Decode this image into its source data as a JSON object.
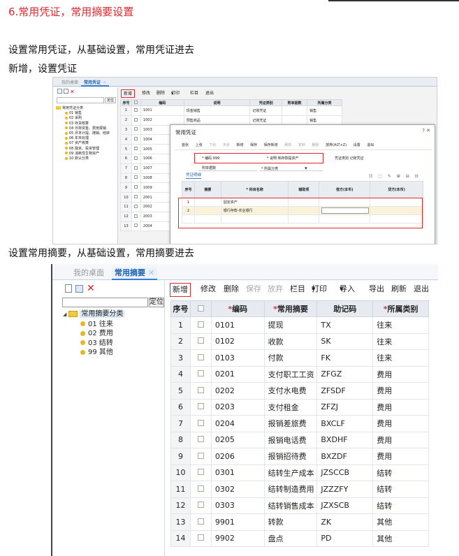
{
  "heading": "6.常用凭证，常用摘要设置",
  "para1": "设置常用凭证，从基础设置，常用凭证进去",
  "para2": "新增，设置凭证",
  "para3": "设置常用摘要，从基础设置，常用摘要进去",
  "shot1": {
    "tabs": [
      {
        "label": "我的桌面"
      },
      {
        "label": "常用凭证"
      }
    ],
    "close_glyph": "✕",
    "locate": "定位",
    "tree": {
      "root": "常用凭证分类",
      "children": [
        "01 销售",
        "02 采购",
        "03 存货核算",
        "04 日常资金、费用报销",
        "05 月末计提、摊销、结转",
        "06 年末处理",
        "07 资产核算",
        "08 融资、投资管理",
        "09 消耗性生物资产",
        "10 默认分类"
      ]
    },
    "toolbar": {
      "new": "新增",
      "edit": "修改",
      "delete": "删除",
      "print": "打印",
      "columns": "栏目",
      "exit": "退出"
    },
    "grid": {
      "headers": [
        "序号",
        "",
        "编码",
        "说明",
        "凭证类别",
        "附单据数",
        "所属分类"
      ],
      "rows": [
        [
          "1",
          "1001",
          "现金销售",
          "记账凭证",
          "销售"
        ],
        [
          "2",
          "1002",
          "预售商品",
          "记账凭证",
          "销售"
        ],
        [
          "3",
          "1003",
          "",
          "",
          ""
        ],
        [
          "4",
          "1004",
          "",
          "",
          ""
        ],
        [
          "5",
          "1005",
          "",
          "",
          ""
        ],
        [
          "6",
          "1006",
          "",
          "",
          ""
        ],
        [
          "7",
          "1007",
          "",
          "",
          ""
        ],
        [
          "8",
          "1008",
          "",
          "",
          ""
        ],
        [
          "9",
          "1009",
          "",
          "",
          ""
        ],
        [
          "10",
          "2001",
          "",
          "",
          ""
        ],
        [
          "11",
          "2002",
          "",
          "",
          ""
        ],
        [
          "12",
          "2003",
          "",
          "",
          ""
        ],
        [
          "13",
          "2004",
          "",
          "",
          ""
        ]
      ]
    },
    "dialog": {
      "title": "常用凭证",
      "controls": "?  ✕",
      "toolbar": [
        "首张",
        "上张",
        "下张",
        "末张",
        "新增",
        "保存",
        "保存新增",
        "刷新",
        "复制",
        "删除",
        "放弃(ALT+Z)",
        "设置",
        "退出"
      ],
      "code_label": "* 编码 999",
      "desc_label": "* 说明 和存款提资产",
      "voucher_type_label": "凭证类别 记账凭证",
      "attach_label": "附单据数",
      "category_label": "* 所属分类",
      "tab": "凭证明细",
      "icons": "☷ ⬚ ✎ ⊞ ⊟ ⊡",
      "headers": [
        "序号",
        "摘要",
        "* 科目名称",
        "辅助项",
        "借方(本币)",
        "贷方(本币)"
      ],
      "rows": [
        {
          "no": "1",
          "subject": "固定资产"
        },
        {
          "no": "2",
          "subject": "银行存款-农业银行"
        }
      ]
    }
  },
  "shot2": {
    "tabs": [
      {
        "label": "我的桌面"
      },
      {
        "label": "常用摘要"
      }
    ],
    "close_glyph": "✕",
    "locate": "定位",
    "tree": {
      "root": "常用摘要分类",
      "children": [
        "01 往来",
        "02 费用",
        "03 结转",
        "99 其他"
      ]
    },
    "toolbar": {
      "new": "新增",
      "edit": "修改",
      "delete": "删除",
      "save": "保存",
      "discard": "放弃",
      "columns": "栏目",
      "print": "打印",
      "import": "导入",
      "export": "导出",
      "refresh": "刷新",
      "exit": "退出"
    },
    "grid": {
      "headers": [
        "序号",
        "",
        "*编码",
        "*常用摘要",
        "助记码",
        "*所属类别"
      ],
      "rows": [
        [
          "1",
          "0101",
          "提现",
          "TX",
          "往来"
        ],
        [
          "2",
          "0102",
          "收款",
          "SK",
          "往来"
        ],
        [
          "3",
          "0103",
          "付款",
          "FK",
          "往来"
        ],
        [
          "4",
          "0201",
          "支付职工工资",
          "ZFGZ",
          "费用"
        ],
        [
          "5",
          "0202",
          "支付水电费",
          "ZFSDF",
          "费用"
        ],
        [
          "6",
          "0203",
          "支付租金",
          "ZFZJ",
          "费用"
        ],
        [
          "7",
          "0204",
          "报销差旅费",
          "BXCLF",
          "费用"
        ],
        [
          "8",
          "0205",
          "报销电话费",
          "BXDHF",
          "费用"
        ],
        [
          "9",
          "0206",
          "报销招待费",
          "BXZDF",
          "费用"
        ],
        [
          "10",
          "0301",
          "结转生产成本",
          "JZSCCB",
          "结转"
        ],
        [
          "11",
          "0302",
          "结转制造费用",
          "JZZZFY",
          "结转"
        ],
        [
          "12",
          "0303",
          "结转销售成本",
          "JZXSCB",
          "结转"
        ],
        [
          "13",
          "9901",
          "转款",
          "ZK",
          "其他"
        ],
        [
          "14",
          "9902",
          "盘点",
          "PD",
          "其他"
        ]
      ]
    }
  }
}
